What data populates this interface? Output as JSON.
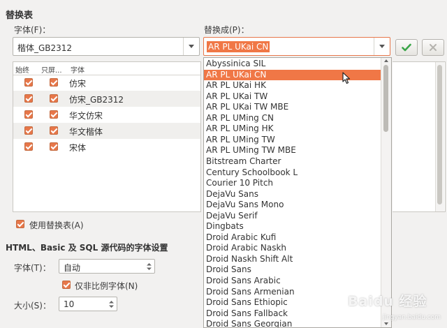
{
  "section": {
    "title": "替换表"
  },
  "font_label": "字体(F)：",
  "font_value": "楷体_GB2312",
  "replace_label": "替换成(P)：",
  "replace_value": "AR PL UKai CN",
  "table": {
    "headers": [
      "始终",
      "只屏...",
      "字体"
    ],
    "rows": [
      {
        "name": "仿宋"
      },
      {
        "name": "仿宋_GB2312"
      },
      {
        "name": "华文仿宋"
      },
      {
        "name": "华文楷体"
      },
      {
        "name": "宋体"
      }
    ]
  },
  "use_table_label": "使用替换表(A)",
  "html_section_title": "HTML、Basic 及 SQL 源代码的字体设置",
  "source_font_label": "字体(T)：",
  "source_font_value": "自动",
  "proportional_label": "仅非比例字体(N)",
  "size_label": "大小(S)：",
  "size_value": "10",
  "dropdown": {
    "selected_index": 1,
    "items": [
      "Abyssinica SIL",
      "AR PL UKai CN",
      "AR PL UKai HK",
      "AR PL UKai TW",
      "AR PL UKai TW MBE",
      "AR PL UMing CN",
      "AR PL UMing HK",
      "AR PL UMing TW",
      "AR PL UMing TW MBE",
      "Bitstream Charter",
      "Century Schoolbook L",
      "Courier 10 Pitch",
      "DejaVu Sans",
      "DejaVu Sans Mono",
      "DejaVu Serif",
      "Dingbats",
      "Droid Arabic Kufi",
      "Droid Arabic Naskh",
      "Droid Naskh Shift Alt",
      "Droid Sans",
      "Droid Sans Arabic",
      "Droid Sans Armenian",
      "Droid Sans Ethiopic",
      "Droid Sans Fallback",
      "Droid Sans Georgian"
    ]
  },
  "watermark": {
    "text": "Baidu 经验",
    "url": "jingyan.baidu.com"
  },
  "colors": {
    "accent": "#f07746",
    "apply_check": "#3aa548"
  }
}
